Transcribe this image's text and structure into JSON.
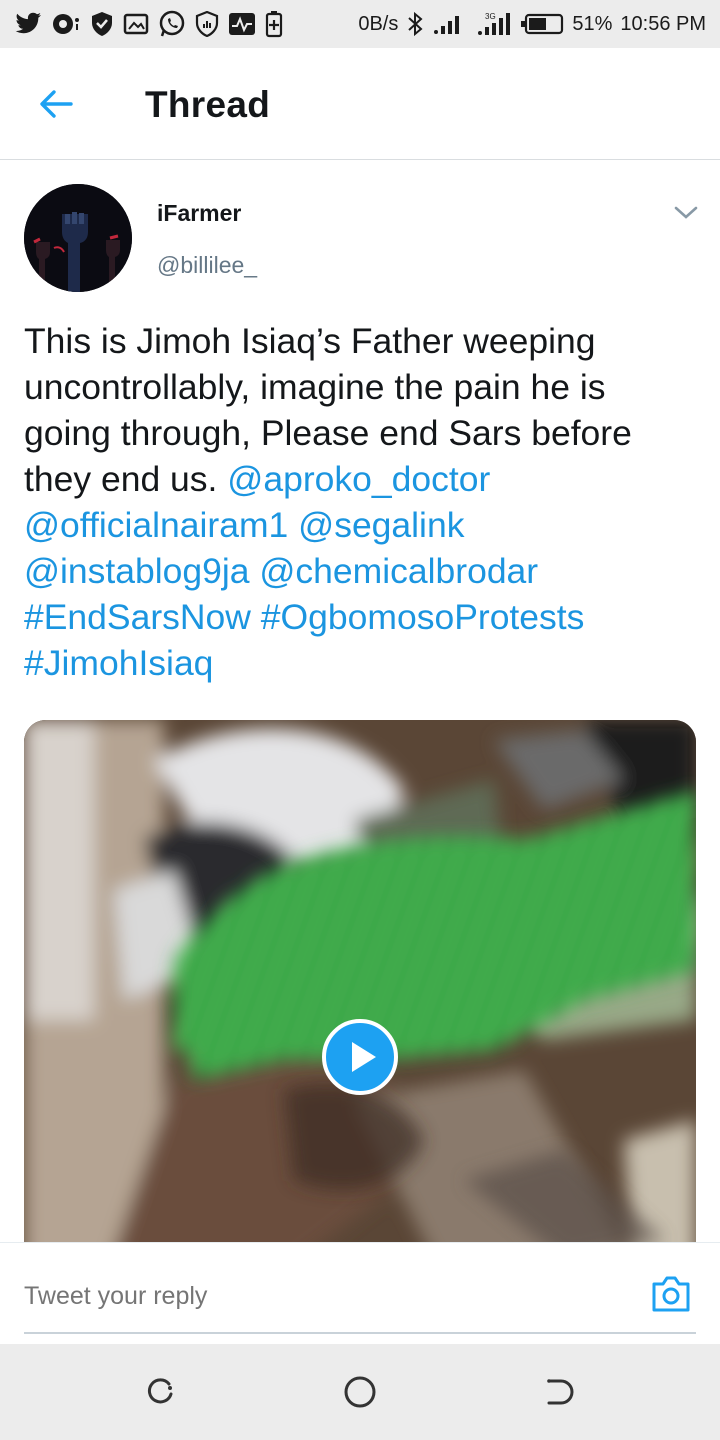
{
  "status_bar": {
    "left_icons": [
      "twitter-icon",
      "notification-icon",
      "shield-icon",
      "gallery-icon",
      "whatsapp-icon",
      "shield-check-icon",
      "activity-icon",
      "battery-saver-icon"
    ],
    "net_speed": "0B/s",
    "network_label": "3G",
    "battery_percent": "51%",
    "time": "10:56 PM"
  },
  "header": {
    "title": "Thread",
    "back_icon": "arrow-left-icon"
  },
  "tweet": {
    "display_name": "iFarmer",
    "handle": "@billilee_",
    "text_plain": "This is Jimoh Isiaq’s Father weeping uncontrollably, imagine the pain he is going through, Please end Sars before they end us.",
    "mentions": [
      "@aproko_doctor",
      "@officialnairam1",
      "@segalink",
      "@instablog9ja",
      "@chemicalbrodar"
    ],
    "hashtags": [
      "#EndSarsNow",
      "#OgbomosoProtests",
      "#JimohIsiaq"
    ],
    "media_type": "video"
  },
  "reply": {
    "placeholder": "Tweet your reply",
    "camera_icon": "camera-icon"
  },
  "colors": {
    "link": "#1b95e0",
    "text": "#14171a",
    "secondary": "#657786",
    "accent": "#1da1f2"
  }
}
